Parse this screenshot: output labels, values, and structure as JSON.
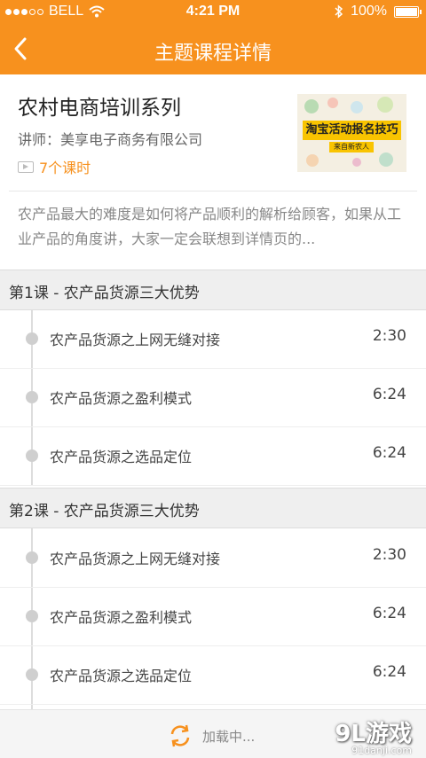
{
  "status_bar": {
    "carrier": "BELL",
    "time": "4:21 PM",
    "battery": "100%",
    "battery_level": 1.0
  },
  "nav": {
    "title": "主题课程详情"
  },
  "course": {
    "title": "农村电商培训系列",
    "instructor": "讲师：美享电子商务有限公司",
    "lesson_count": "7个课时",
    "thumbnail_title": "淘宝活动报名技巧",
    "thumbnail_subtitle": "来自新农人",
    "description": "农产品最大的难度是如何将产品顺利的解析给顾客，如果从工业产品的角度讲，大家一定会联想到详情页的..."
  },
  "sections": [
    {
      "title": "第1课 - 农产品货源三大优势",
      "items": [
        {
          "name": "农产品货源之上网无缝对接",
          "duration": "2:30"
        },
        {
          "name": "农产品货源之盈利模式",
          "duration": "6:24"
        },
        {
          "name": "农产品货源之选品定位",
          "duration": "6:24"
        }
      ]
    },
    {
      "title": "第2课 - 农产品货源三大优势",
      "items": [
        {
          "name": "农产品货源之上网无缝对接",
          "duration": "2:30"
        },
        {
          "name": "农产品货源之盈利模式",
          "duration": "6:24"
        },
        {
          "name": "农产品货源之选品定位",
          "duration": "6:24"
        }
      ]
    }
  ],
  "footer": {
    "loading_text": "加载中..."
  },
  "watermark": {
    "main": "9L游戏",
    "sub": "91danji.com"
  },
  "colors": {
    "accent": "#f7911e"
  }
}
